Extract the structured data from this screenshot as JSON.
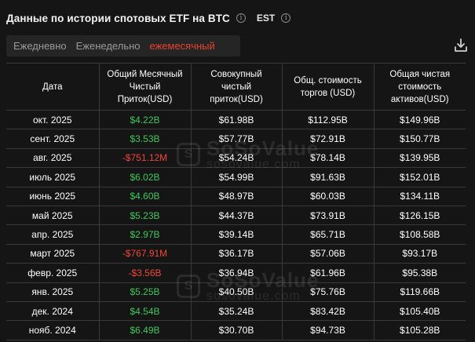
{
  "header": {
    "title": "Данные по истории спотовых ETF на BTC",
    "title_info_icon": "info-icon",
    "timezone": "EST",
    "timezone_info_icon": "info-icon"
  },
  "tabs": [
    {
      "label": "Ежедневно",
      "active": false
    },
    {
      "label": "Еженедельно",
      "active": false
    },
    {
      "label": "ежемесячный",
      "active": true
    }
  ],
  "toolbar": {
    "download_icon": "download-icon"
  },
  "table": {
    "columns": [
      "Дата",
      "Общий Месячный Чистый Приток(USD)",
      "Совокупный чистый приток(USD)",
      "Общ. стоимость торгов (USD)",
      "Общая чистая стоимость активов(USD)"
    ],
    "rows": [
      {
        "date": "окт. 2025",
        "monthly_inflow": "$4.22B",
        "sign": "pos",
        "cumulative": "$61.98B",
        "volume": "$112.95B",
        "assets": "$149.96B"
      },
      {
        "date": "сент. 2025",
        "monthly_inflow": "$3.53B",
        "sign": "pos",
        "cumulative": "$57.77B",
        "volume": "$72.91B",
        "assets": "$150.77B"
      },
      {
        "date": "авг. 2025",
        "monthly_inflow": "-$751.12M",
        "sign": "neg",
        "cumulative": "$54.24B",
        "volume": "$78.14B",
        "assets": "$139.95B"
      },
      {
        "date": "июль 2025",
        "monthly_inflow": "$6.02B",
        "sign": "pos",
        "cumulative": "$54.99B",
        "volume": "$91.63B",
        "assets": "$152.01B"
      },
      {
        "date": "июнь 2025",
        "monthly_inflow": "$4.60B",
        "sign": "pos",
        "cumulative": "$48.97B",
        "volume": "$60.03B",
        "assets": "$134.11B"
      },
      {
        "date": "май 2025",
        "monthly_inflow": "$5.23B",
        "sign": "pos",
        "cumulative": "$44.37B",
        "volume": "$73.91B",
        "assets": "$126.15B"
      },
      {
        "date": "апр. 2025",
        "monthly_inflow": "$2.97B",
        "sign": "pos",
        "cumulative": "$39.14B",
        "volume": "$65.71B",
        "assets": "$108.58B"
      },
      {
        "date": "март 2025",
        "monthly_inflow": "-$767.91M",
        "sign": "neg",
        "cumulative": "$36.17B",
        "volume": "$57.06B",
        "assets": "$93.17B"
      },
      {
        "date": "февр. 2025",
        "monthly_inflow": "-$3.56B",
        "sign": "neg",
        "cumulative": "$36.94B",
        "volume": "$61.96B",
        "assets": "$95.38B"
      },
      {
        "date": "янв. 2025",
        "monthly_inflow": "$5.25B",
        "sign": "pos",
        "cumulative": "$40.50B",
        "volume": "$75.76B",
        "assets": "$119.66B"
      },
      {
        "date": "дек. 2024",
        "monthly_inflow": "$4.54B",
        "sign": "pos",
        "cumulative": "$35.24B",
        "volume": "$83.42B",
        "assets": "$105.40B"
      },
      {
        "date": "нояб. 2024",
        "monthly_inflow": "$6.49B",
        "sign": "pos",
        "cumulative": "$30.70B",
        "volume": "$94.73B",
        "assets": "$105.28B"
      }
    ]
  },
  "watermark": {
    "brand": "SoSoValue",
    "site": "sosovalue.com",
    "logo_letter": "S"
  },
  "colors": {
    "positive": "#3fc75d",
    "negative": "#f0473b",
    "active_tab": "#e8432f",
    "background": "#151515"
  }
}
